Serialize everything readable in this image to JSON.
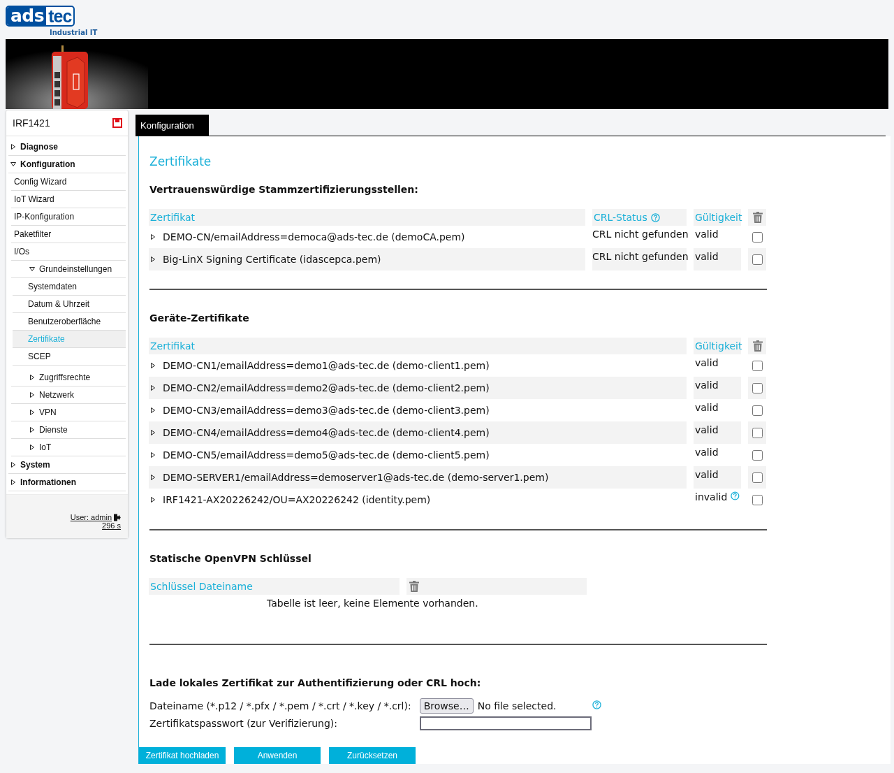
{
  "logo": {
    "left": "ads",
    "right": "tec",
    "tagline": "Industrial IT"
  },
  "banner": {
    "kind": "picture"
  },
  "sidebar": {
    "device": "IRF1421",
    "items": [
      {
        "label": "Diagnose",
        "expanded": false,
        "selected": false
      },
      {
        "label": "Konfiguration",
        "expanded": true,
        "selected": false,
        "children": [
          {
            "label": "Config Wizard",
            "selected": false
          },
          {
            "label": "IoT Wizard",
            "selected": false
          },
          {
            "label": "IP-Konfiguration",
            "selected": false
          },
          {
            "label": "Paketfilter",
            "selected": false
          },
          {
            "label": "I/Os",
            "selected": false
          },
          {
            "label": "Grundeinstellungen",
            "expanded": true,
            "selected": false,
            "children": [
              {
                "label": "Systemdaten",
                "selected": false
              },
              {
                "label": "Datum & Uhrzeit",
                "selected": false
              },
              {
                "label": "Benutzeroberfläche",
                "selected": false
              },
              {
                "label": "Zertifikate",
                "selected": true
              },
              {
                "label": "SCEP",
                "selected": false
              }
            ]
          },
          {
            "label": "Zugriffsrechte",
            "expanded": false,
            "selected": false
          },
          {
            "label": "Netzwerk",
            "expanded": false,
            "selected": false
          },
          {
            "label": "VPN",
            "expanded": false,
            "selected": false
          },
          {
            "label": "Dienste",
            "expanded": false,
            "selected": false
          },
          {
            "label": "IoT",
            "expanded": false,
            "selected": false
          }
        ]
      },
      {
        "label": "System",
        "expanded": false,
        "selected": false
      },
      {
        "label": "Informationen",
        "expanded": false,
        "selected": false
      }
    ],
    "user": "User: admin",
    "timer": "296 s"
  },
  "tabs": [
    {
      "label": "Konfiguration",
      "selected": true
    }
  ],
  "page_title": "Zertifikate",
  "trusted_ca": {
    "heading": "Vertrauenswürdige Stammzertifizierungsstellen:",
    "columns": [
      {
        "label": "Zertifikat",
        "kind": "plain"
      },
      {
        "label": "CRL-Status",
        "kind": "help"
      },
      {
        "label": "Gültigkeit",
        "kind": "plain"
      }
    ],
    "rows": [
      {
        "certificate": "DEMO-CN/emailAddress=democa@ads-tec.de (demoCA.pem)",
        "crl_status": "CRL nicht gefunden",
        "validity": "valid",
        "expanded": false,
        "checked": false
      },
      {
        "certificate": "Big-LinX Signing Certificate (idascepca.pem)",
        "crl_status": "CRL nicht gefunden",
        "validity": "valid",
        "expanded": false,
        "checked": false
      }
    ]
  },
  "device_certificates": {
    "heading": "Geräte-Zertifikate",
    "columns": [
      {
        "label": "Zertifikat",
        "kind": "plain"
      },
      {
        "label": "Gültigkeit",
        "kind": "plain"
      }
    ],
    "rows": [
      {
        "certificate": "DEMO-CN1/emailAddress=demo1@ads-tec.de (demo-client1.pem)",
        "validity": "valid",
        "help": false,
        "expanded": false,
        "checked": false
      },
      {
        "certificate": "DEMO-CN2/emailAddress=demo2@ads-tec.de (demo-client2.pem)",
        "validity": "valid",
        "help": false,
        "expanded": false,
        "checked": false
      },
      {
        "certificate": "DEMO-CN3/emailAddress=demo3@ads-tec.de (demo-client3.pem)",
        "validity": "valid",
        "help": false,
        "expanded": false,
        "checked": false
      },
      {
        "certificate": "DEMO-CN4/emailAddress=demo4@ads-tec.de (demo-client4.pem)",
        "validity": "valid",
        "help": false,
        "expanded": false,
        "checked": false
      },
      {
        "certificate": "DEMO-CN5/emailAddress=demo5@ads-tec.de (demo-client5.pem)",
        "validity": "valid",
        "help": false,
        "expanded": false,
        "checked": false
      },
      {
        "certificate": "DEMO-SERVER1/emailAddress=demoserver1@ads-tec.de (demo-server1.pem)",
        "validity": "valid",
        "help": false,
        "expanded": false,
        "checked": false
      },
      {
        "certificate": "IRF1421-AX20226242/OU=AX20226242 (identity.pem)",
        "validity": "invalid",
        "help": true,
        "expanded": false,
        "checked": false
      }
    ]
  },
  "openvpn_keys": {
    "heading": "Statische OpenVPN Schlüssel",
    "columns": [
      {
        "label": "Schlüssel Dateiname",
        "kind": "plain"
      }
    ],
    "empty_message": "Tabelle ist leer, keine Elemente vorhanden."
  },
  "upload": {
    "heading": "Lade lokales Zertifikat zur Authentifizierung oder CRL hoch:",
    "file_label": "Dateiname (*.p12 / *.pfx / *.pem / *.crt / *.key / *.crl):",
    "browse_button": "Browse…",
    "file_status": "No file selected.",
    "password_label": "Zertifikatspasswort (zur Verifizierung):"
  },
  "buttons": [
    "Zertifikat hochladen",
    "Anwenden",
    "Zurücksetzen"
  ]
}
